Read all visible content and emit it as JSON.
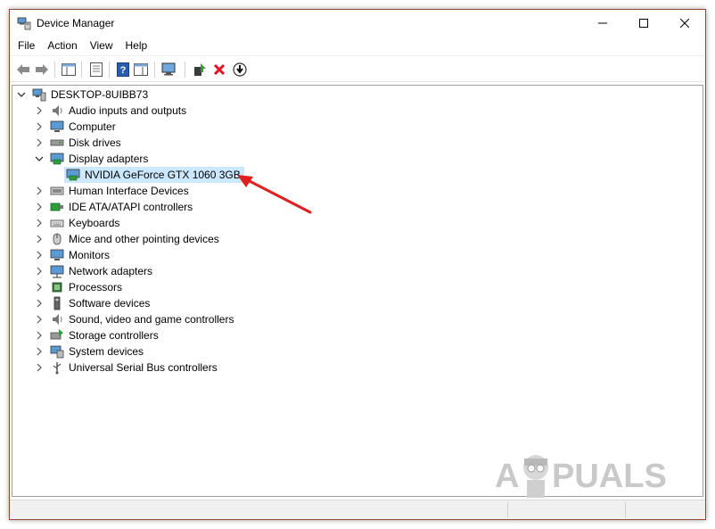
{
  "window": {
    "title": "Device Manager"
  },
  "menu": [
    "File",
    "Action",
    "View",
    "Help"
  ],
  "tree": {
    "root": "DESKTOP-8UIBB73",
    "categories": [
      {
        "label": "Audio inputs and outputs",
        "expanded": false
      },
      {
        "label": "Computer",
        "expanded": false
      },
      {
        "label": "Disk drives",
        "expanded": false
      },
      {
        "label": "Display adapters",
        "expanded": true
      },
      {
        "label": "Human Interface Devices",
        "expanded": false
      },
      {
        "label": "IDE ATA/ATAPI controllers",
        "expanded": false
      },
      {
        "label": "Keyboards",
        "expanded": false
      },
      {
        "label": "Mice and other pointing devices",
        "expanded": false
      },
      {
        "label": "Monitors",
        "expanded": false
      },
      {
        "label": "Network adapters",
        "expanded": false
      },
      {
        "label": "Processors",
        "expanded": false
      },
      {
        "label": "Software devices",
        "expanded": false
      },
      {
        "label": "Sound, video and game controllers",
        "expanded": false
      },
      {
        "label": "Storage controllers",
        "expanded": false
      },
      {
        "label": "System devices",
        "expanded": false
      },
      {
        "label": "Universal Serial Bus controllers",
        "expanded": false
      }
    ],
    "display_child": "NVIDIA GeForce GTX 1060 3GB"
  },
  "watermark": {
    "text_a": "A",
    "text_rest": "PUALS"
  },
  "colors": {
    "selection": "#cce8ff",
    "arrow": "#e02020",
    "delete": "#e81123",
    "install": "#2e9e3a"
  }
}
